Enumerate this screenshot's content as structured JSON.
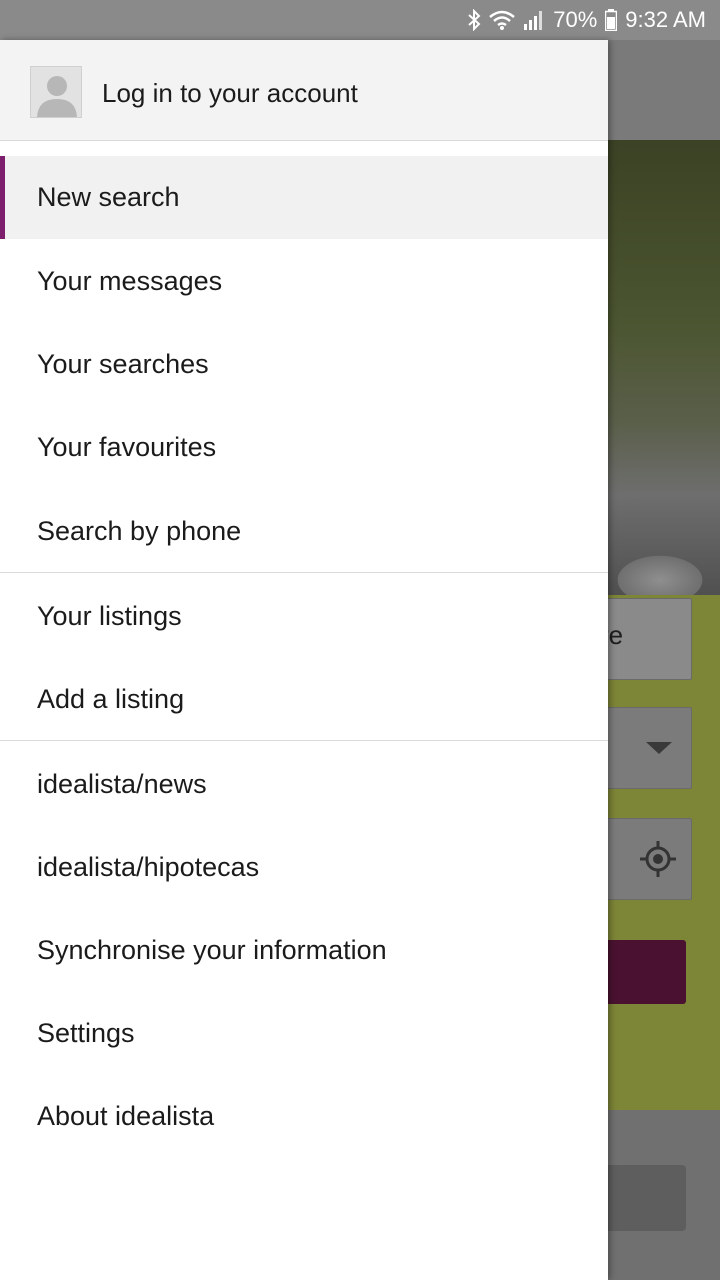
{
  "status_bar": {
    "battery": "70%",
    "time": "9:32 AM",
    "icons": [
      "bluetooth-icon",
      "wifi-icon",
      "signal-icon",
      "battery-icon"
    ]
  },
  "background": {
    "fragment_text": "re"
  },
  "drawer": {
    "header": {
      "avatar_icon": "user-avatar-icon",
      "login_label": "Log in to your account"
    },
    "groups": [
      {
        "items": [
          {
            "label": "New search",
            "active": true
          },
          {
            "label": "Your messages"
          },
          {
            "label": "Your searches"
          },
          {
            "label": "Your favourites"
          },
          {
            "label": "Search by phone"
          }
        ]
      },
      {
        "items": [
          {
            "label": "Your listings"
          },
          {
            "label": "Add a listing"
          }
        ]
      },
      {
        "items": [
          {
            "label": "idealista/news"
          },
          {
            "label": "idealista/hipotecas"
          },
          {
            "label": "Synchronise your information"
          },
          {
            "label": "Settings"
          },
          {
            "label": "About idealista"
          }
        ]
      }
    ]
  },
  "colors": {
    "accent": "#7e1f6d",
    "panel_green": "#7d8537",
    "button_dark": "#4a1230"
  }
}
